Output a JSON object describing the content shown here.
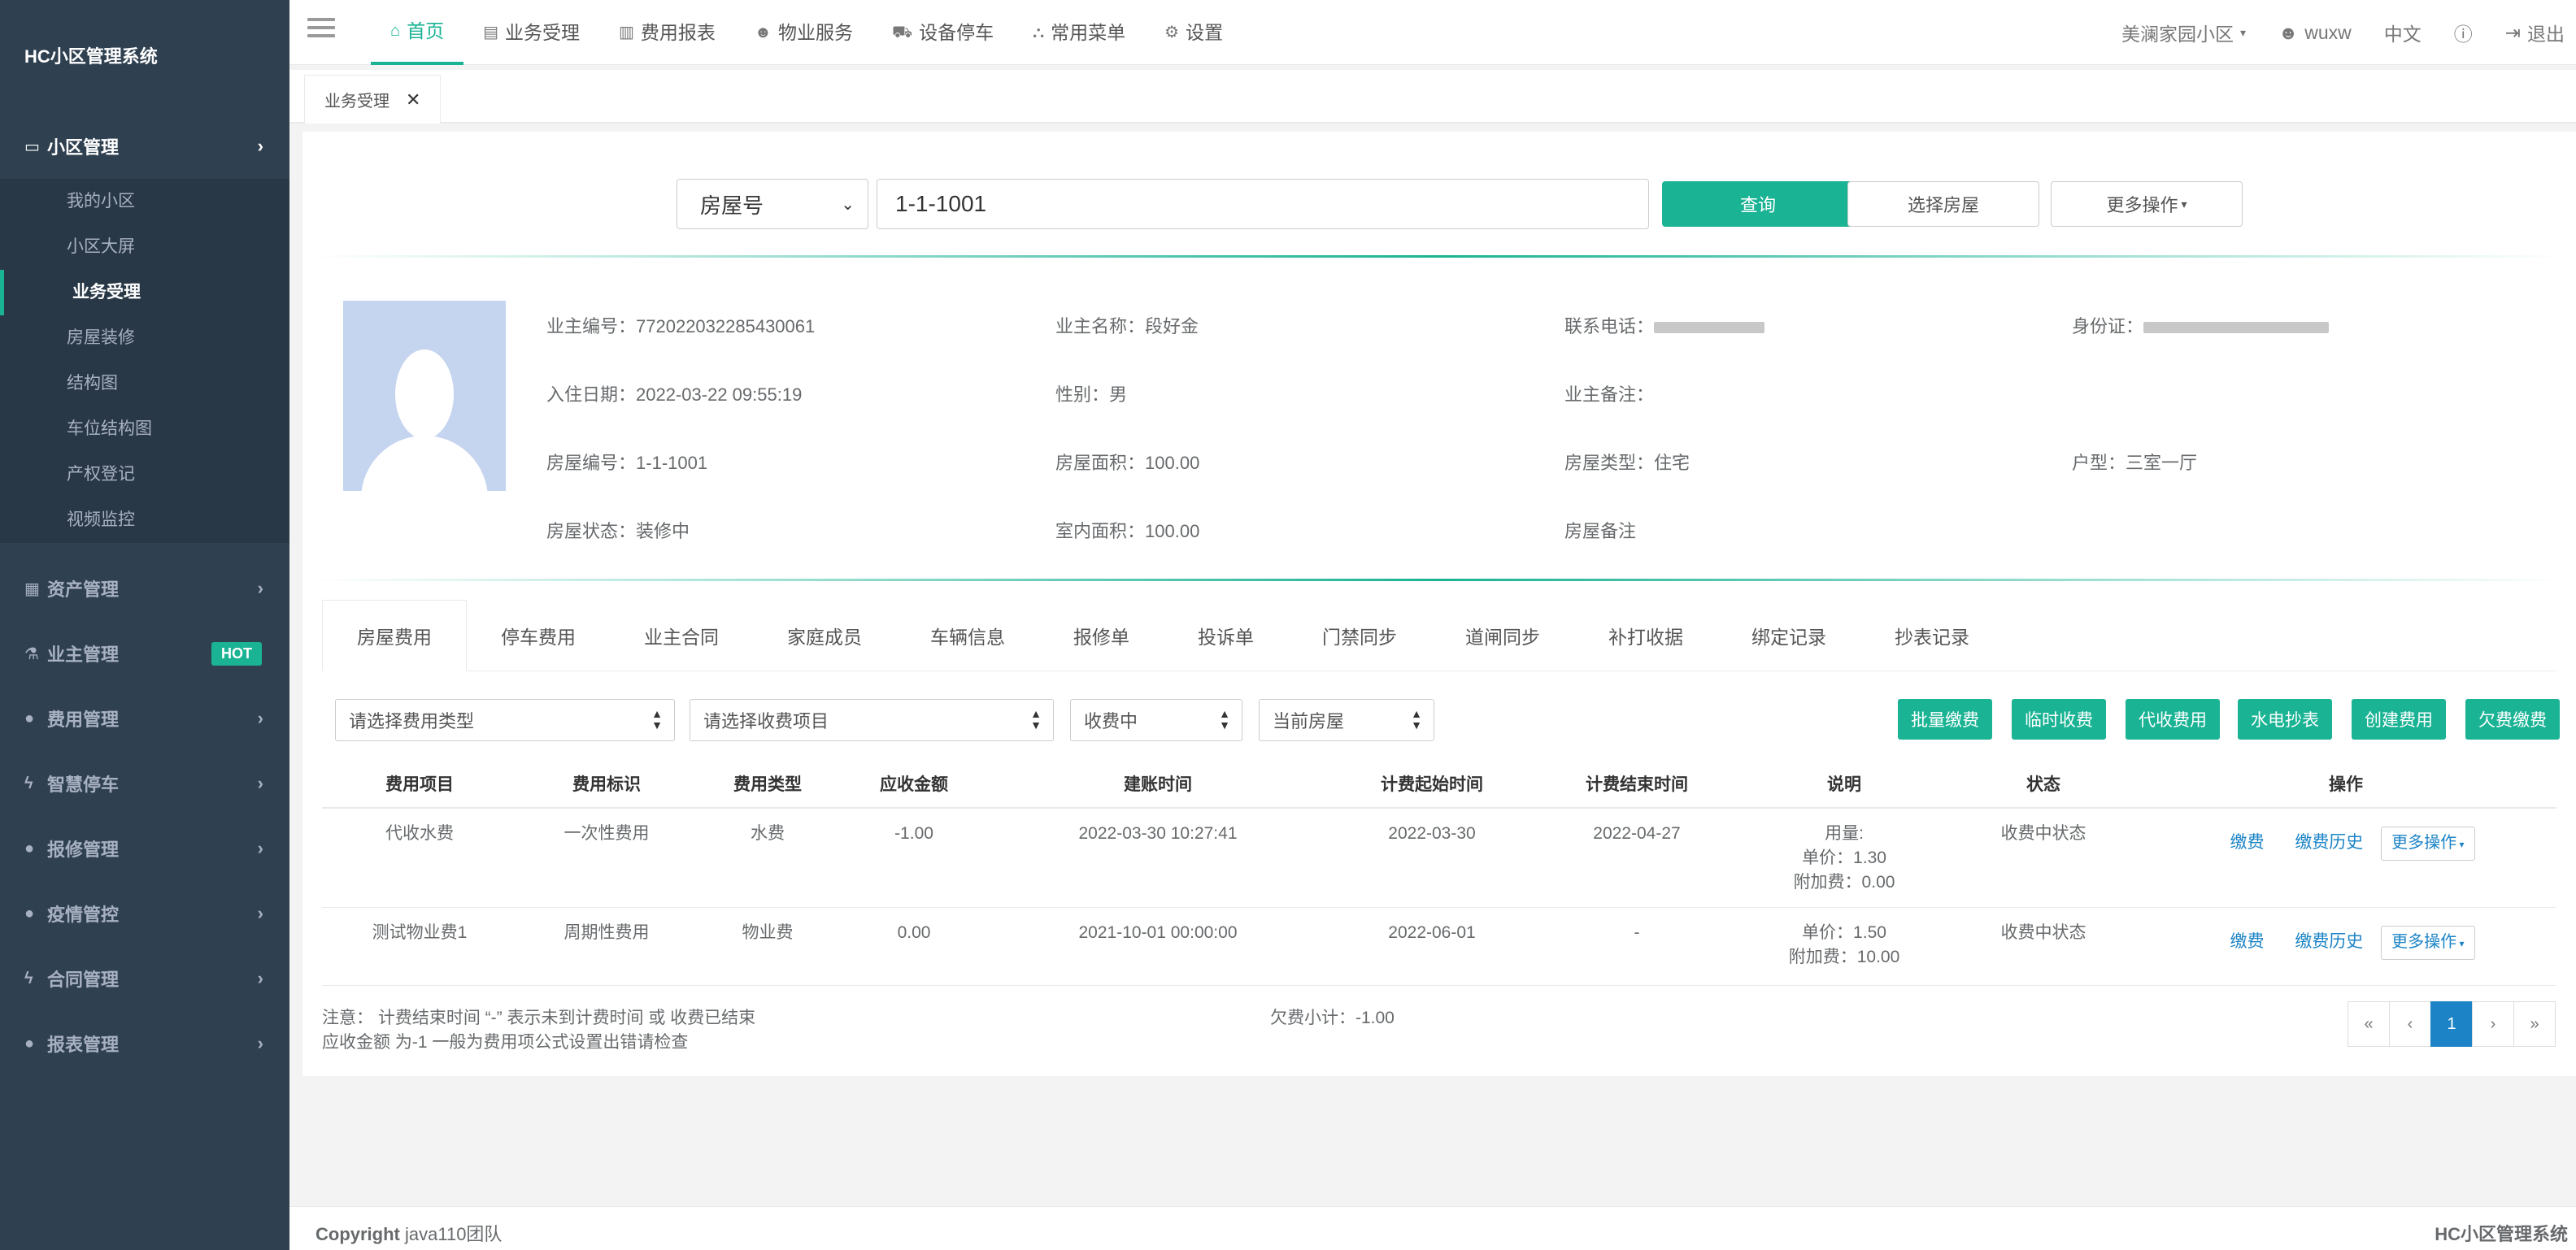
{
  "app": {
    "brand": "HC小区管理系统"
  },
  "sidebar": {
    "groups": [
      {
        "label": "小区管理",
        "icon": "monitor-icon",
        "items": [
          "我的小区",
          "小区大屏",
          "业务受理",
          "房屋装修",
          "结构图",
          "车位结构图",
          "产权登记",
          "视频监控"
        ],
        "current": "业务受理"
      },
      {
        "label": "资产管理",
        "icon": "grid-icon"
      },
      {
        "label": "业主管理",
        "icon": "flask-icon",
        "badge": "HOT"
      },
      {
        "label": "费用管理",
        "icon": "globe-icon"
      },
      {
        "label": "智慧停车",
        "icon": "bolt-icon"
      },
      {
        "label": "报修管理",
        "icon": "globe-icon"
      },
      {
        "label": "疫情管控",
        "icon": "globe-icon"
      },
      {
        "label": "合同管理",
        "icon": "bolt-icon"
      },
      {
        "label": "报表管理",
        "icon": "globe-icon"
      }
    ]
  },
  "topnav": {
    "items": [
      "首页",
      "业务受理",
      "费用报表",
      "物业服务",
      "设备停车",
      "常用菜单",
      "设置"
    ],
    "community": "美澜家园小区",
    "user": "wuxw",
    "lang": "中文",
    "logout": "退出"
  },
  "page_tab": {
    "label": "业务受理"
  },
  "search": {
    "type_value": "房屋号",
    "input_value": "1-1-1001",
    "query_label": "查询",
    "choose_label": "选择房屋",
    "more_label": "更多操作"
  },
  "owner": {
    "id_label": "业主编号：",
    "id_value": "772022032285430061",
    "name_label": "业主名称：",
    "name_value": "段好金",
    "phone_label": "联系电话：",
    "idcard_label": "身份证：",
    "checkin_label": "入住日期：",
    "checkin_value": "2022-03-22 09:55:19",
    "gender_label": "性别：",
    "gender_value": "男",
    "remark_label": "业主备注：",
    "room_no_label": "房屋编号：",
    "room_no_value": "1-1-1001",
    "area_label": "房屋面积：",
    "area_value": "100.00",
    "room_type_label": "房屋类型：",
    "room_type_value": "住宅",
    "layout_label": "户型：",
    "layout_value": "三室一厅",
    "status_label": "房屋状态：",
    "status_value": "装修中",
    "inner_area_label": "室内面积：",
    "inner_area_value": "100.00",
    "room_remark_label": "房屋备注"
  },
  "inner_tabs": [
    "房屋费用",
    "停车费用",
    "业主合同",
    "家庭成员",
    "车辆信息",
    "报修单",
    "投诉单",
    "门禁同步",
    "道闸同步",
    "补打收据",
    "绑定记录",
    "抄表记录"
  ],
  "filters": {
    "fee_type": "请选择费用类型",
    "fee_item": "请选择收费项目",
    "state": "收费中",
    "scope": "当前房屋"
  },
  "action_buttons": [
    "批量缴费",
    "临时收费",
    "代收费用",
    "水电抄表",
    "创建费用",
    "欠费缴费"
  ],
  "table": {
    "headers": [
      "费用项目",
      "费用标识",
      "费用类型",
      "应收金额",
      "建账时间",
      "计费起始时间",
      "计费结束时间",
      "说明",
      "状态",
      "操作"
    ],
    "rows": [
      {
        "item": "代收水费",
        "flag": "一次性费用",
        "type": "水费",
        "amount": "-1.00",
        "created": "2022-03-30 10:27:41",
        "start": "2022-03-30",
        "end": "2022-04-27",
        "desc1": "用量:",
        "desc2": "单价：1.30",
        "desc3": "附加费：0.00",
        "status": "收费中状态"
      },
      {
        "item": "测试物业费1",
        "flag": "周期性费用",
        "type": "物业费",
        "amount": "0.00",
        "created": "2021-10-01 00:00:00",
        "start": "2022-06-01",
        "end": "-",
        "desc1": "单价：1.50",
        "desc2": "附加费：10.00",
        "desc3": "",
        "status": "收费中状态"
      }
    ],
    "op_pay": "缴费",
    "op_history": "缴费历史",
    "op_more": "更多操作"
  },
  "notes": {
    "line1": "注意：  计费结束时间 “-” 表示未到计费时间 或 收费已结束",
    "line2": "应收金额 为-1 一般为费用项公式设置出错请检查",
    "subtotal": "欠费小计：-1.00"
  },
  "pagination": {
    "first": "«",
    "prev": "‹",
    "current": "1",
    "next": "›",
    "last": "»"
  },
  "footer": {
    "left_bold": "Copyright",
    "left_rest": " java110团队",
    "right": "HC小区管理系统"
  }
}
